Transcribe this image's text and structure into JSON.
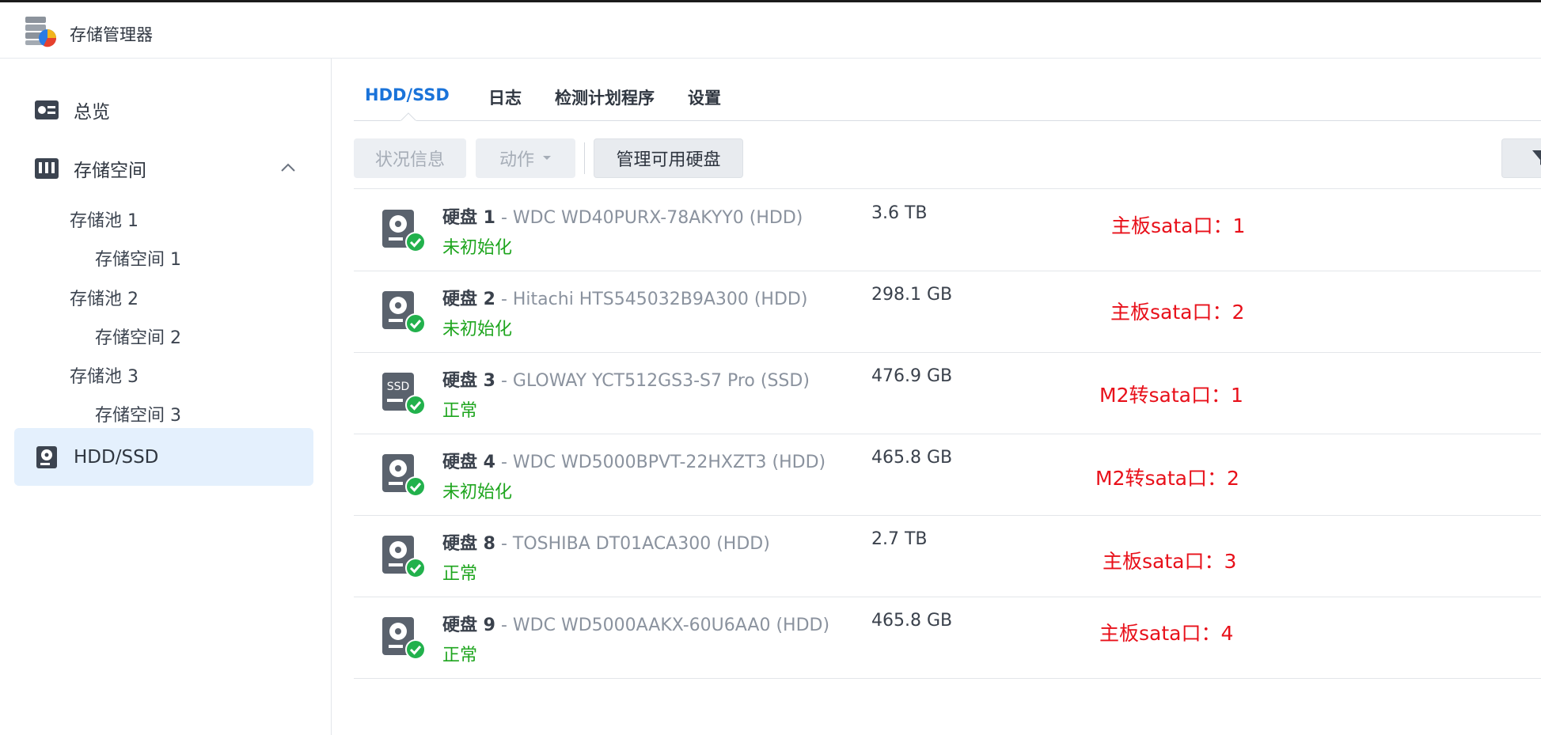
{
  "app": {
    "title": "存储管理器"
  },
  "sidebar": {
    "overview": "总览",
    "storage": "存储空间",
    "pools": [
      {
        "label": "存储池 1",
        "volume": "存储空间 1"
      },
      {
        "label": "存储池 2",
        "volume": "存储空间 2"
      },
      {
        "label": "存储池 3",
        "volume": "存储空间 3"
      }
    ],
    "hdd": "HDD/SSD"
  },
  "tabs": [
    "HDD/SSD",
    "日志",
    "检测计划程序",
    "设置"
  ],
  "toolbar": {
    "status_info": "状况信息",
    "action": "动作",
    "manage": "管理可用硬盘"
  },
  "disks": [
    {
      "label": "硬盘 1",
      "model": " - WDC WD40PURX-78AKYY0 (HDD)",
      "status": "未初始化",
      "size": "3.6 TB",
      "type": "hdd",
      "note": "主板sata口：1"
    },
    {
      "label": "硬盘 2",
      "model": " - Hitachi HTS545032B9A300 (HDD)",
      "status": "未初始化",
      "size": "298.1 GB",
      "type": "hdd",
      "note": "主板sata口：2"
    },
    {
      "label": "硬盘 3",
      "model": " - GLOWAY YCT512GS3-S7 Pro (SSD)",
      "status": "正常",
      "size": "476.9 GB",
      "type": "ssd",
      "ssd_text": "SSD",
      "note": "M2转sata口：1"
    },
    {
      "label": "硬盘 4",
      "model": " - WDC WD5000BPVT-22HXZT3 (HDD)",
      "status": "未初始化",
      "size": "465.8 GB",
      "type": "hdd",
      "note": "M2转sata口：2"
    },
    {
      "label": "硬盘 8",
      "model": " - TOSHIBA DT01ACA300 (HDD)",
      "status": "正常",
      "size": "2.7 TB",
      "type": "hdd",
      "note": "主板sata口：3"
    },
    {
      "label": "硬盘 9",
      "model": " - WDC WD5000AAKX-60U6AA0 (HDD)",
      "status": "正常",
      "size": "465.8 GB",
      "type": "hdd",
      "note": "主板sata口：4"
    }
  ],
  "colors": {
    "accent": "#1a73d9",
    "ok": "#1ea51e",
    "note": "#e8101a",
    "active_bg": "#e4f0fd"
  }
}
